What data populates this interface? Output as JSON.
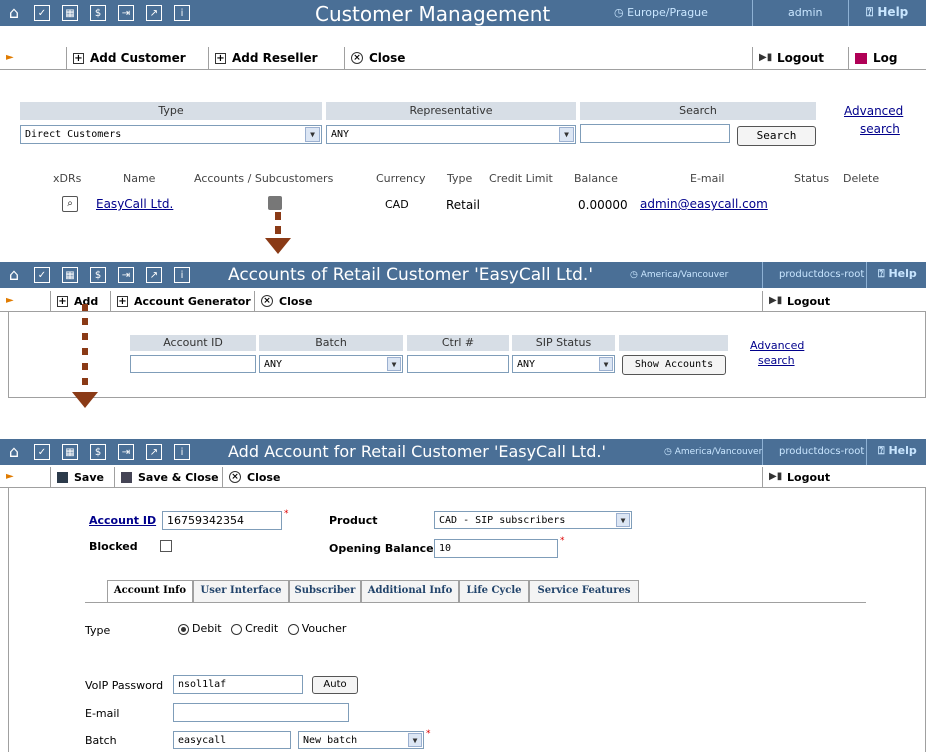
{
  "screen1": {
    "title": "Customer Management",
    "timezone": "Europe/Prague",
    "user": "admin",
    "help": "Help",
    "toolbar": {
      "add_customer": "Add Customer",
      "add_reseller": "Add Reseller",
      "close": "Close",
      "logout": "Logout",
      "log": "Log"
    },
    "filters": {
      "type_header": "Type",
      "representative_header": "Representative",
      "search_header": "Search",
      "type_value": "Direct Customers",
      "representative_value": "ANY",
      "search_value": "",
      "search_button": "Search",
      "advanced_link_1": "Advanced",
      "advanced_link_2": "search"
    },
    "table": {
      "columns": [
        "xDRs",
        "Name",
        "Accounts / Subcustomers",
        "Currency",
        "Type",
        "Credit Limit",
        "Balance",
        "E-mail",
        "Status",
        "Delete"
      ],
      "rows": [
        {
          "name": "EasyCall Ltd.",
          "currency": "CAD",
          "type": "Retail",
          "credit_limit": "",
          "balance": "0.00000",
          "email": "admin@easycall.com",
          "status": ""
        }
      ]
    }
  },
  "screen2": {
    "title": "Accounts of Retail Customer 'EasyCall Ltd.'",
    "timezone": "America/Vancouver",
    "user": "productdocs-root",
    "help": "Help",
    "toolbar": {
      "add": "Add",
      "account_generator": "Account Generator",
      "close": "Close",
      "logout": "Logout"
    },
    "filters": {
      "account_id_header": "Account ID",
      "batch_header": "Batch",
      "ctrl_header": "Ctrl #",
      "sip_status_header": "SIP Status",
      "account_id_value": "",
      "batch_value": "ANY",
      "ctrl_value": "",
      "sip_status_value": "ANY",
      "show_button": "Show Accounts",
      "advanced_link_1": "Advanced",
      "advanced_link_2": "search"
    }
  },
  "screen3": {
    "title": "Add Account for Retail Customer 'EasyCall Ltd.'",
    "timezone": "America/Vancouver",
    "user": "productdocs-root",
    "help": "Help",
    "toolbar": {
      "save": "Save",
      "save_close": "Save & Close",
      "close": "Close",
      "logout": "Logout"
    },
    "form": {
      "account_id_label": "Account ID",
      "account_id_value": "16759342354",
      "blocked_label": "Blocked",
      "product_label": "Product",
      "product_value": "CAD - SIP subscribers",
      "opening_balance_label": "Opening Balance",
      "opening_balance_value": "10"
    },
    "tabs": [
      "Account Info",
      "User Interface",
      "Subscriber",
      "Additional Info",
      "Life Cycle",
      "Service Features"
    ],
    "account_info": {
      "type_label": "Type",
      "type_options": [
        "Debit",
        "Credit",
        "Voucher"
      ],
      "voip_password_label": "VoIP Password",
      "voip_password_value": "nsol1laf",
      "auto_button": "Auto",
      "email_label": "E-mail",
      "email_value": "",
      "batch_label": "Batch",
      "batch_value": "easycall",
      "batch_select_value": "New batch"
    }
  },
  "colors": {
    "titlebar": "#4a6f96",
    "header_cell": "#d7dee6",
    "link": "#00008b",
    "arrow": "#8a3a16"
  }
}
